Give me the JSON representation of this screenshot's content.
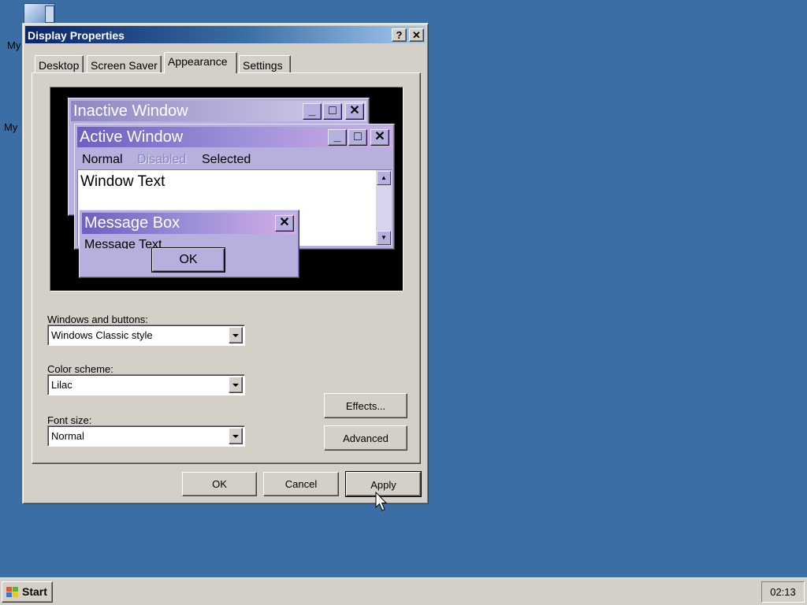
{
  "desktop": {
    "icons": [
      {
        "label": "My",
        "icon": "computer-icon"
      },
      {
        "label": "My",
        "icon": "network-icon"
      }
    ]
  },
  "dialog": {
    "title": "Display Properties",
    "help_glyph": "?",
    "close_glyph": "✕",
    "tabs": [
      {
        "label": "Desktop"
      },
      {
        "label": "Screen Saver"
      },
      {
        "label": "Appearance",
        "active": true
      },
      {
        "label": "Settings"
      }
    ],
    "preview": {
      "inactive_title": "Inactive Window",
      "active_title": "Active Window",
      "menu": {
        "normal": "Normal",
        "disabled": "Disabled",
        "selected": "Selected"
      },
      "window_text": "Window Text",
      "message_box_title": "Message Box",
      "message_text": "Message Text",
      "ok_label": "OK",
      "colors": {
        "title_active": "#6e5fc0",
        "title_inactive": "#8d86c4",
        "face": "#b5b0dd"
      }
    },
    "windows_and_buttons": {
      "label": "Windows and buttons:",
      "value": "Windows Classic style"
    },
    "color_scheme": {
      "label": "Color scheme:",
      "value": "Lilac"
    },
    "font_size": {
      "label": "Font size:",
      "value": "Normal"
    },
    "effects_label": "Effects...",
    "advanced_label": "Advanced",
    "ok_label": "OK",
    "cancel_label": "Cancel",
    "apply_label": "Apply"
  },
  "taskbar": {
    "start_label": "Start",
    "clock": "02:13"
  }
}
